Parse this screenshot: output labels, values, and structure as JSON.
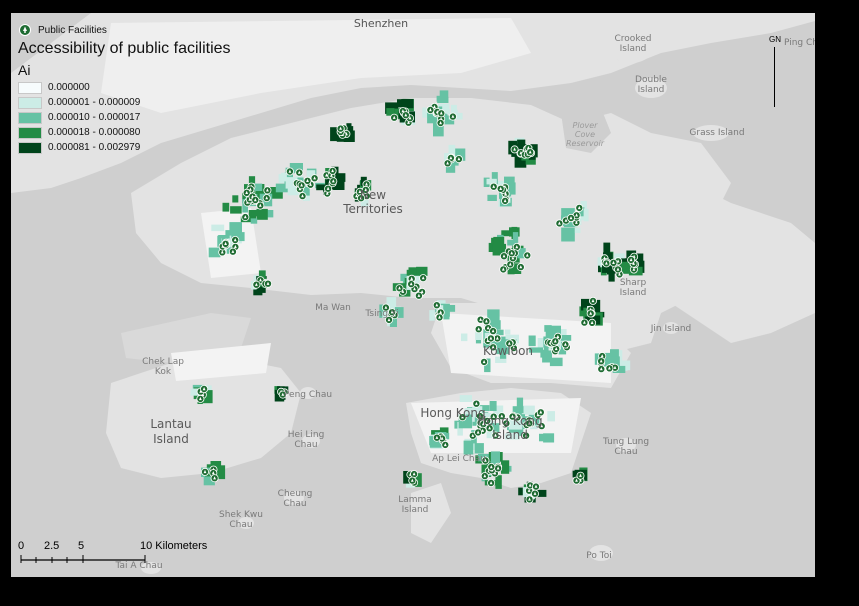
{
  "legend": {
    "facility_label": "Public Facilities",
    "title": "Accessibility of public facilities",
    "field": "Ai",
    "classes": [
      {
        "label": "0.000000",
        "color": "#f7fcfd"
      },
      {
        "label": "0.000001 - 0.000009",
        "color": "#ccece6"
      },
      {
        "label": "0.000010 - 0.000017",
        "color": "#66c2a4"
      },
      {
        "label": "0.000018 - 0.000080",
        "color": "#238b45"
      },
      {
        "label": "0.000081 - 0.002979",
        "color": "#00441b"
      }
    ]
  },
  "north_arrow": {
    "label": "GN"
  },
  "scale_bar": {
    "ticks": [
      "0",
      "2.5",
      "5",
      "10 Kilometers"
    ]
  },
  "places": {
    "shenzhen": "Shenzhen",
    "new_territories": [
      "New",
      "Territories"
    ],
    "kowloon": "Kowloon",
    "hong_kong": "Hong Kong",
    "hong_kong_island": [
      "Hong Kong",
      "Island"
    ],
    "lantau_island": [
      "Lantau",
      "Island"
    ],
    "crooked_island": [
      "Crooked",
      "Island"
    ],
    "double_island": [
      "Double",
      "Island"
    ],
    "grass_island": "Grass Island",
    "ping_chau": "Ping Ch",
    "plover_cove": [
      "Plover",
      "Cove",
      "Reservoir"
    ],
    "sharp_island": [
      "Sharp",
      "Island"
    ],
    "jin_island": "Jin Island",
    "ma_wan": "Ma Wan",
    "tsing_yi": "Tsing Yi",
    "chek_lap_kok": [
      "Chek Lap",
      "Kok"
    ],
    "peng_chau": "Peng Chau",
    "hei_ling_chau": [
      "Hei Ling",
      "Chau"
    ],
    "cheung_chau": [
      "Cheung",
      "Chau"
    ],
    "shek_kwu_chau": [
      "Shek Kwu",
      "Chau"
    ],
    "lamma_island": [
      "Lamma",
      "Island"
    ],
    "ap_lei_chau": "Ap Lei Chau",
    "tung_lung_chau": [
      "Tung Lung",
      "Chau"
    ],
    "po_toi": "Po Toi",
    "tai_a_chau": "Tai A Chau"
  },
  "colors": {
    "water": "#cfcfcf",
    "land": "#e3e3e3",
    "urban": "#f0f0f0",
    "facility_marker": "#1e6b32"
  }
}
